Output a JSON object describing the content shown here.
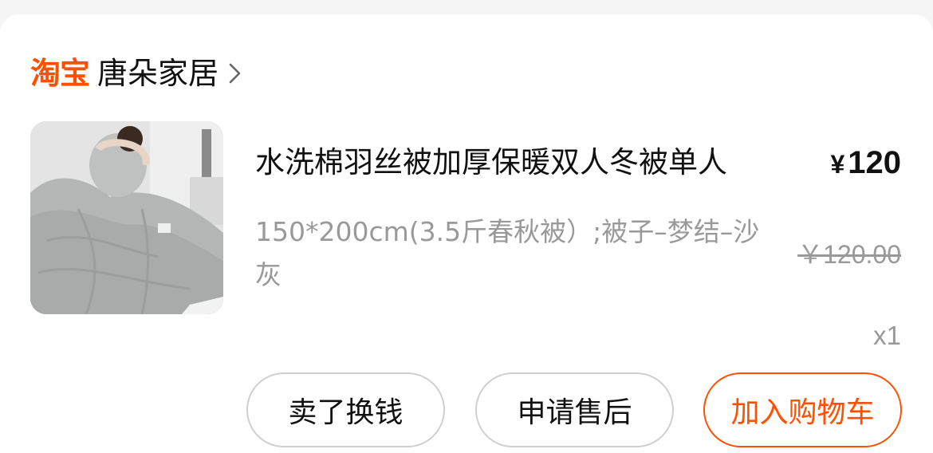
{
  "shop": {
    "brand": "淘宝",
    "name": "唐朵家居",
    "chevron_icon": "chevron-right-icon"
  },
  "product": {
    "image_icon": "product-thumbnail-duvet",
    "title": "水洗棉羽丝被加厚保暖双人冬被单人",
    "price_symbol": "¥",
    "price": "120",
    "spec": "150*200cm(3.5斤春秋被）;被子–梦结–沙灰",
    "original_price": "￥120.00",
    "quantity": "x1"
  },
  "actions": {
    "sell": "卖了换钱",
    "after_sales": "申请售后",
    "add_to_cart": "加入购物车"
  },
  "colors": {
    "accent": "#ff5000",
    "text_primary": "#111111",
    "text_secondary": "#999999",
    "border": "#cfcfcf"
  }
}
